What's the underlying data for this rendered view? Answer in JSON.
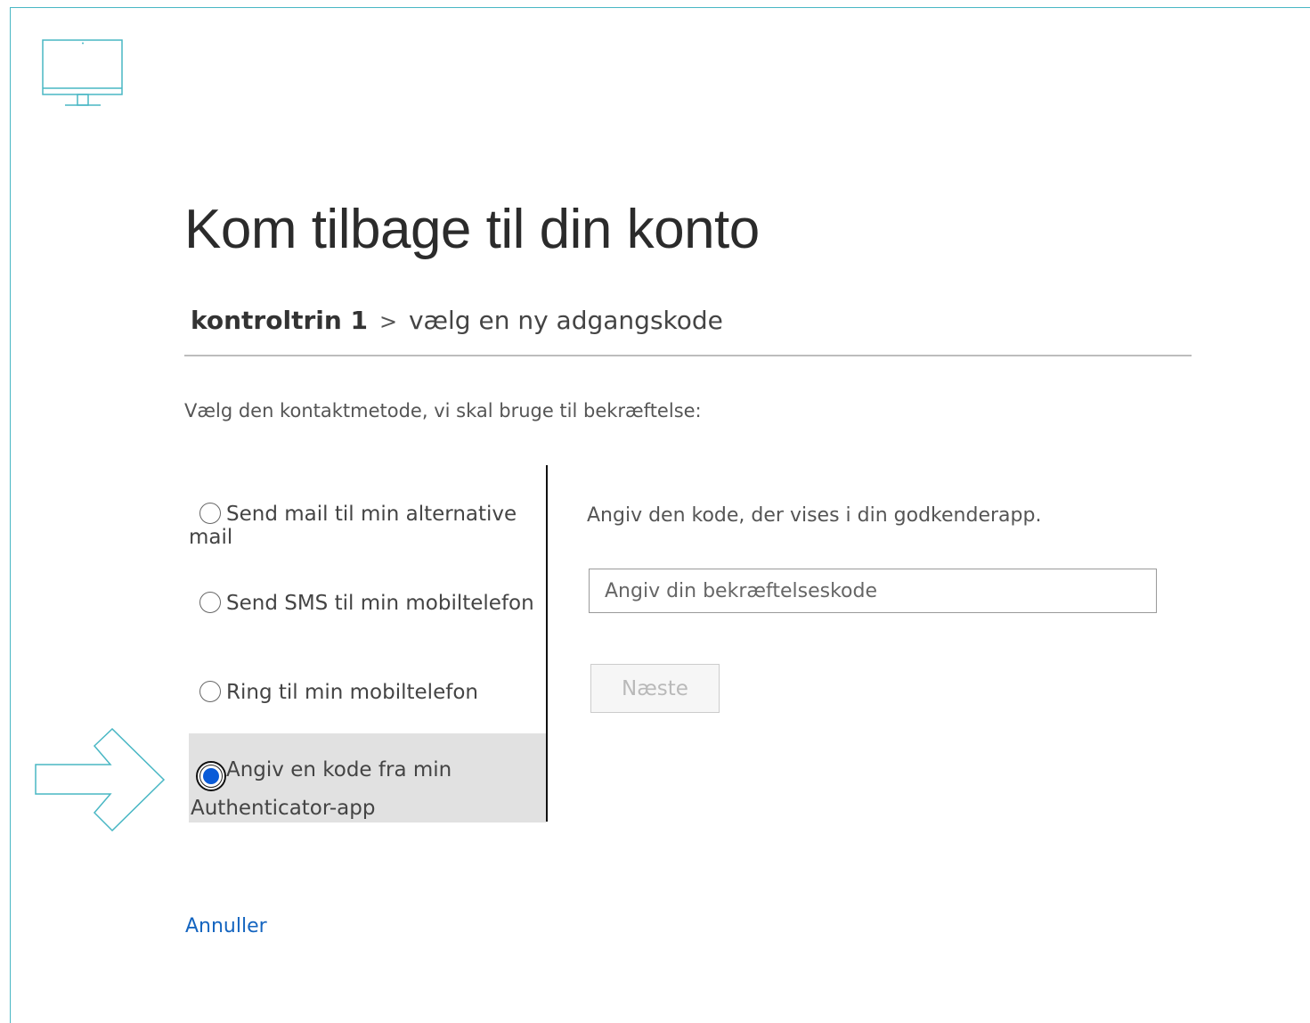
{
  "page": {
    "title": "Kom tilbage til din konto"
  },
  "breadcrumb": {
    "current": "kontroltrin 1",
    "separator": ">",
    "next": "vælg en ny adgangskode"
  },
  "prompt": "Vælg den kontaktmetode, vi skal bruge til bekræftelse:",
  "options": [
    {
      "label": "Send mail til min alternative mail",
      "selected": false
    },
    {
      "label": "Send SMS til min mobiltelefon",
      "selected": false
    },
    {
      "label": "Ring til min mobiltelefon",
      "selected": false
    },
    {
      "label_line1": "Angiv en kode fra min",
      "label_line2": "Authenticator-app",
      "selected": true
    }
  ],
  "right_panel": {
    "description": "Angiv den kode, der vises i din godkenderapp.",
    "input_placeholder": "Angiv din bekræftelseskode",
    "input_value": "",
    "next_label": "Næste"
  },
  "cancel_label": "Annuller",
  "colors": {
    "accent": "#49b7c4",
    "link": "#1565c0",
    "radio_selected": "#0a5bd8",
    "selected_bg": "#e1e1e1"
  },
  "icons": {
    "logo": "monitor-icon",
    "pointer": "arrow-right-icon"
  }
}
